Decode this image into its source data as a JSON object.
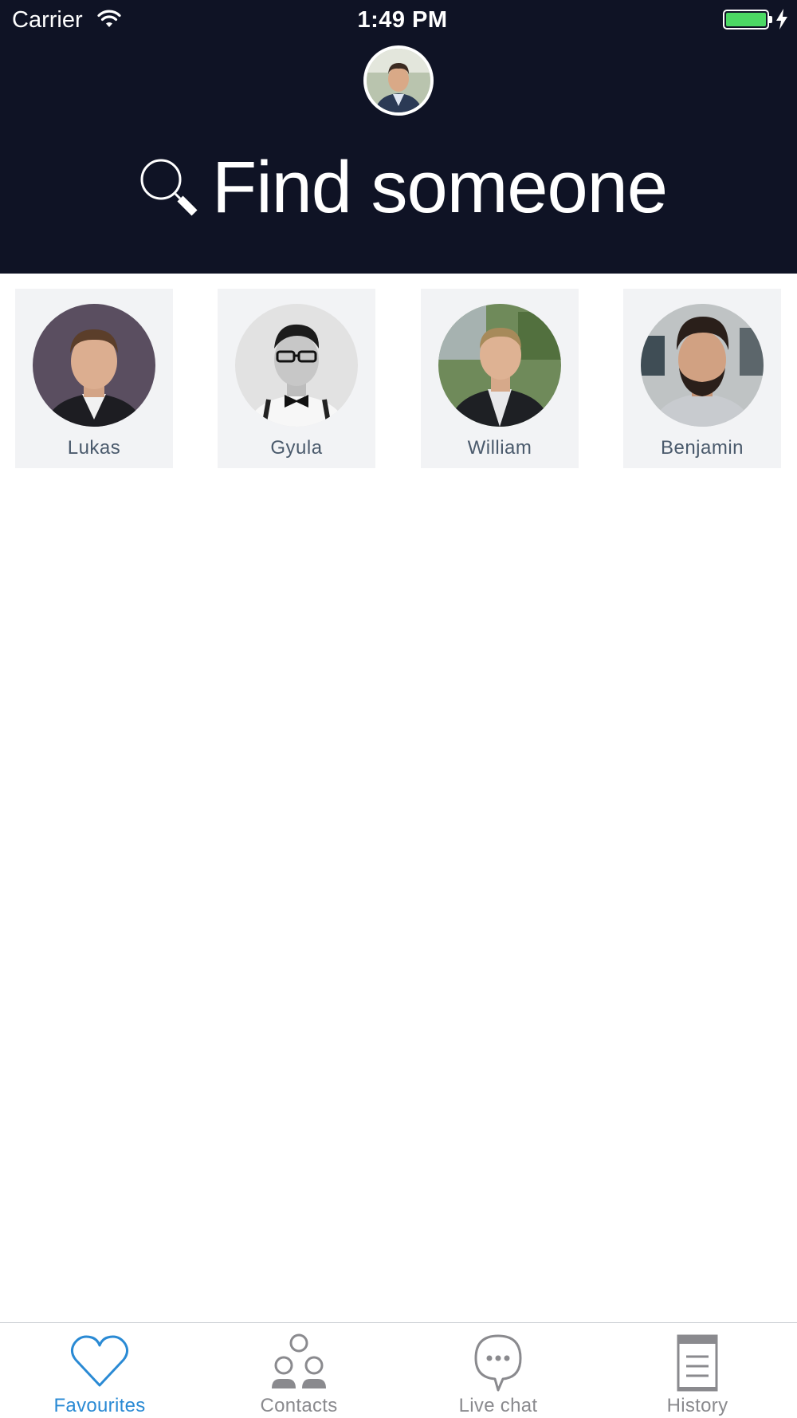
{
  "status_bar": {
    "carrier": "Carrier",
    "time": "1:49 PM",
    "battery_color": "#4cd964"
  },
  "header": {
    "background": "#0f1325",
    "profile_avatar": "user-photo",
    "search_label": "Find someone",
    "search_icon": "magnifier-icon"
  },
  "favourites": [
    {
      "name": "Lukas"
    },
    {
      "name": "Gyula"
    },
    {
      "name": "William"
    },
    {
      "name": "Benjamin"
    }
  ],
  "tabbar": {
    "active_color": "#2a8ad4",
    "tabs": [
      {
        "label": "Favourites",
        "icon": "heart-icon",
        "active": true
      },
      {
        "label": "Contacts",
        "icon": "people-icon",
        "active": false
      },
      {
        "label": "Live chat",
        "icon": "chat-bubble-icon",
        "active": false
      },
      {
        "label": "History",
        "icon": "document-icon",
        "active": false
      }
    ]
  }
}
